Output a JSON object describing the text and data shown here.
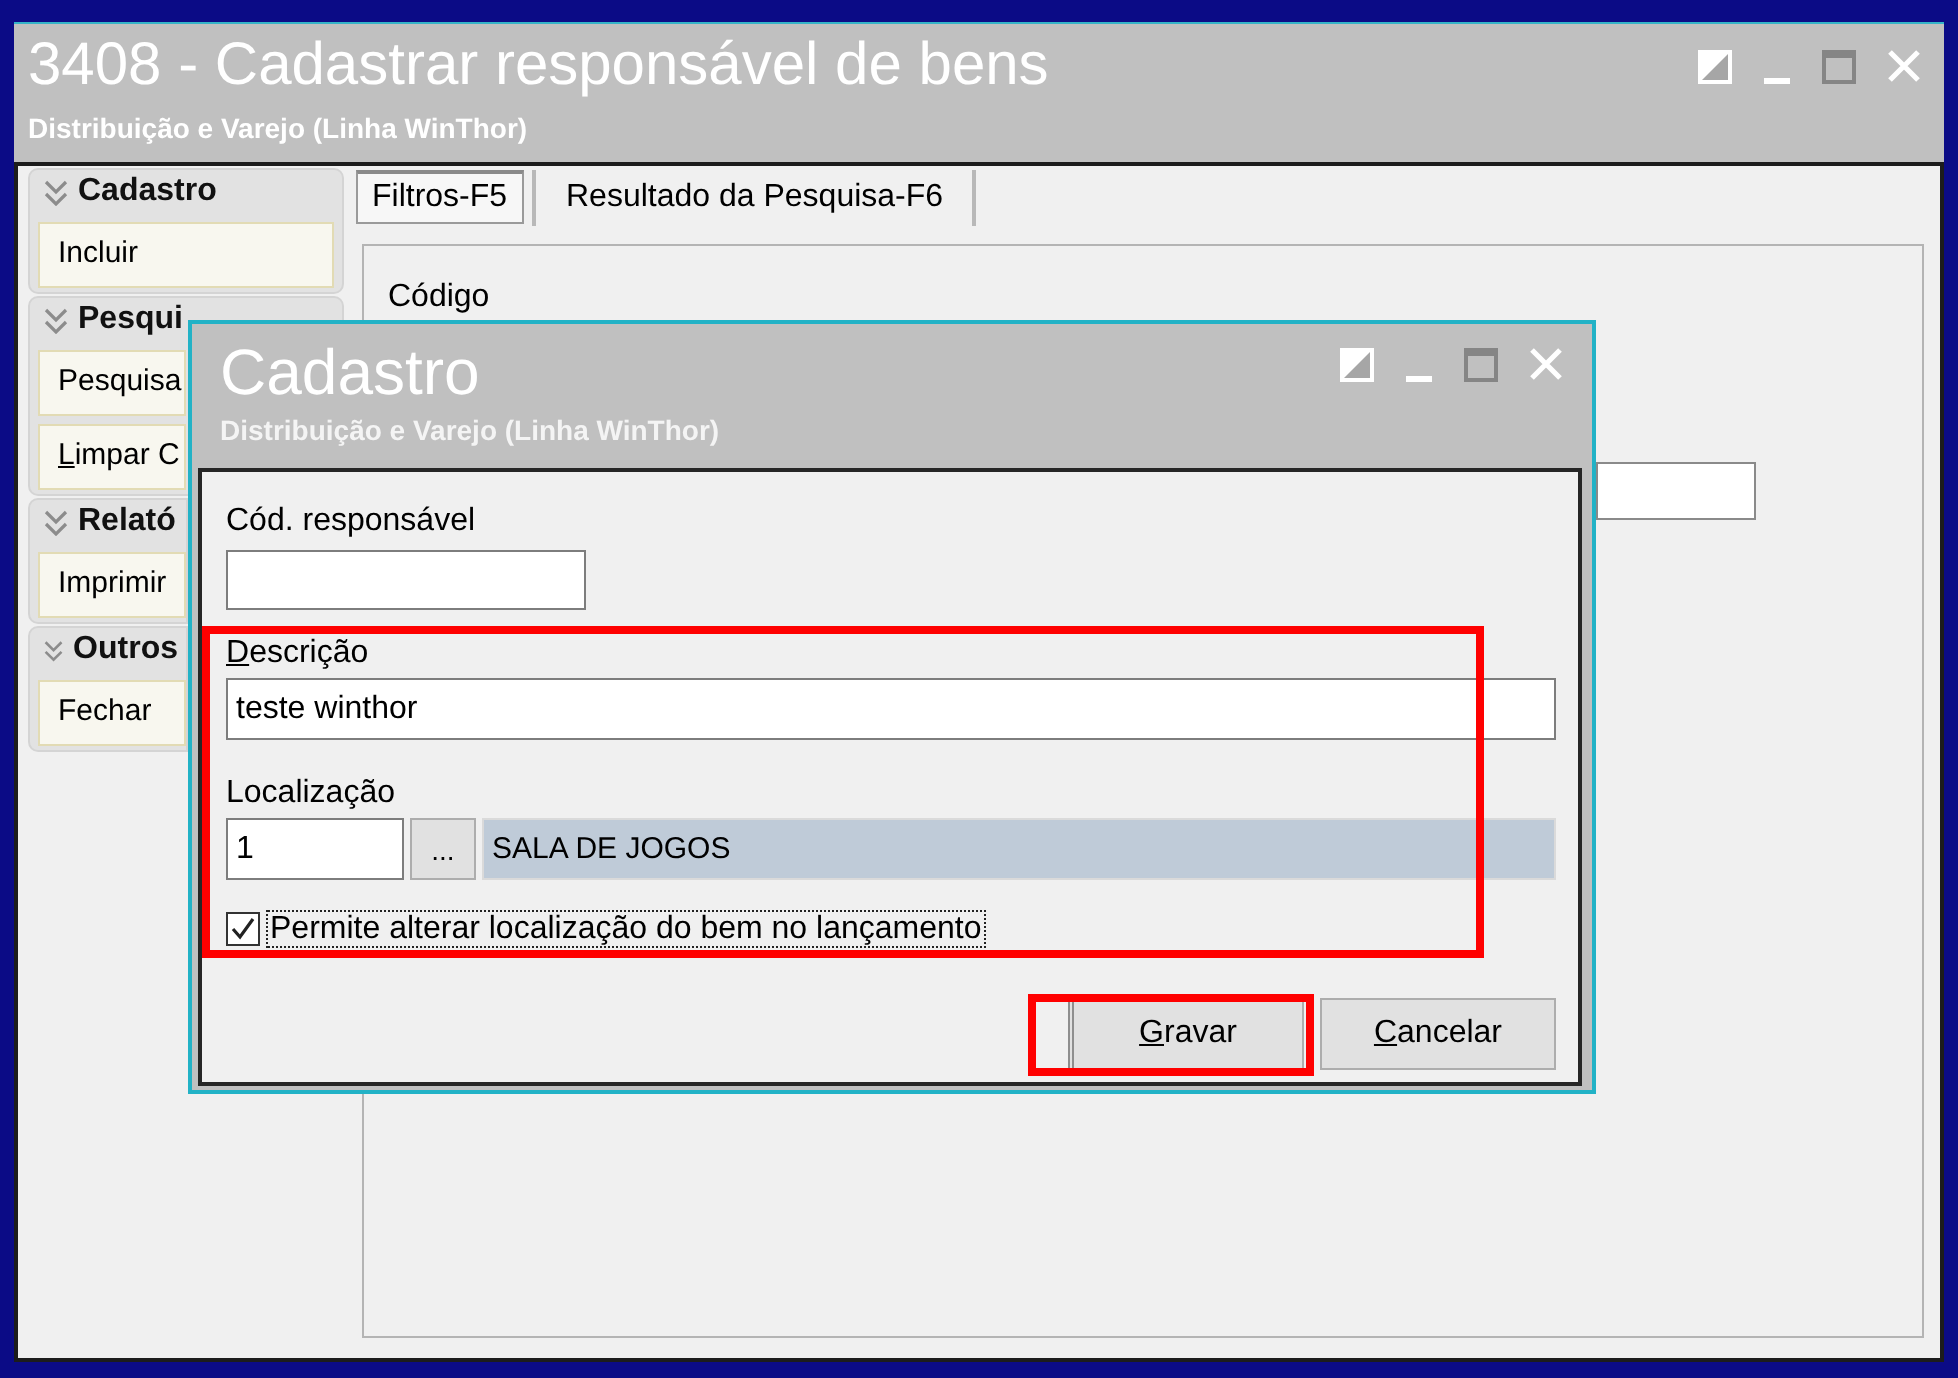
{
  "window": {
    "title": "3408 - Cadastrar responsável de bens",
    "subtitle": "Distribuição e Varejo (Linha WinThor)",
    "controls": [
      {
        "kind": "half"
      },
      {
        "kind": "minimize"
      },
      {
        "kind": "maximize"
      },
      {
        "kind": "close"
      }
    ]
  },
  "sidebar": [
    {
      "title": "Cadastro",
      "buttons": [
        {
          "label": "Incluir",
          "underline_first": false
        }
      ]
    },
    {
      "title": "Pesqui",
      "buttons": [
        {
          "label": "Pesquisa",
          "underline_first": false
        },
        {
          "label": "Limpar C",
          "underline_first": true
        }
      ]
    },
    {
      "title": "Relató",
      "buttons": [
        {
          "label": "Imprimir",
          "underline_first": false
        }
      ]
    },
    {
      "title": "Outros",
      "buttons": [
        {
          "label": "Fechar",
          "underline_first": false
        }
      ]
    }
  ],
  "tabs": [
    {
      "label": "Filtros-F5",
      "selected": true
    },
    {
      "label": "Resultado da Pesquisa-F6",
      "selected": false
    }
  ],
  "filter_panel": {
    "fields": [
      {
        "label": "Código"
      }
    ]
  },
  "dialog": {
    "title": "Cadastro",
    "subtitle": "Distribuição e Varejo (Linha WinThor)",
    "controls": [
      {
        "kind": "half"
      },
      {
        "kind": "minimize"
      },
      {
        "kind": "maximize"
      },
      {
        "kind": "close"
      }
    ],
    "sections": [
      {
        "highlighted": false,
        "fields": [
          {
            "kind": "code",
            "label": "Cód. responsável",
            "underline_first": false
          }
        ]
      },
      {
        "highlighted": true,
        "fields": [
          {
            "kind": "text",
            "label": "Descrição",
            "underline_first": true,
            "value": "teste winthor"
          },
          {
            "kind": "lookup",
            "label": "Localização",
            "underline_first": false,
            "value": "1",
            "button": "...",
            "description": "SALA DE JOGOS"
          },
          {
            "kind": "checkbox",
            "label": "Permite alterar localização do bem no lançamento",
            "checked": true,
            "focused": true
          }
        ]
      }
    ],
    "buttons": [
      {
        "label": "Gravar",
        "underline_first": true,
        "highlighted": true
      },
      {
        "label": "Cancelar",
        "underline_first": true,
        "highlighted": false
      }
    ]
  }
}
